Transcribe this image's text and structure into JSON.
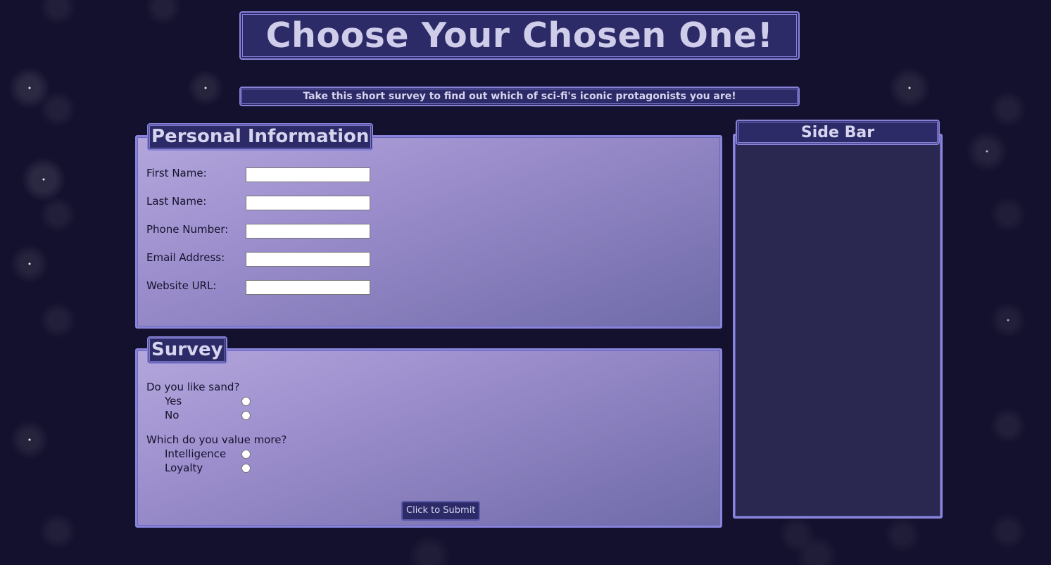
{
  "header": {
    "title": "Choose Your Chosen One!",
    "subtitle": "Take this short survey to find out which of sci-fi's iconic protagonists you are!"
  },
  "personal": {
    "legend": "Personal Information",
    "fields": [
      {
        "label": "First Name:",
        "value": ""
      },
      {
        "label": "Last Name:",
        "value": ""
      },
      {
        "label": "Phone Number:",
        "value": ""
      },
      {
        "label": "Email Address:",
        "value": ""
      },
      {
        "label": "Website URL:",
        "value": ""
      }
    ]
  },
  "survey": {
    "legend": "Survey",
    "questions": [
      {
        "text": "Do you like sand?",
        "options": [
          "Yes",
          "No"
        ]
      },
      {
        "text": "Which do you value more?",
        "options": [
          "Intelligence",
          "Loyalty"
        ]
      }
    ],
    "submit_label": "Click to Submit"
  },
  "sidebar": {
    "title": "Side Bar"
  },
  "colors": {
    "background": "#13112d",
    "header_fill": "#2c2a67",
    "border": "#8782d8",
    "panel_gradient_start": "#b3a6dc",
    "panel_gradient_end": "#6e6aa8",
    "sidebar_fill": "#2a2850",
    "text_light": "#d6d4ee"
  }
}
